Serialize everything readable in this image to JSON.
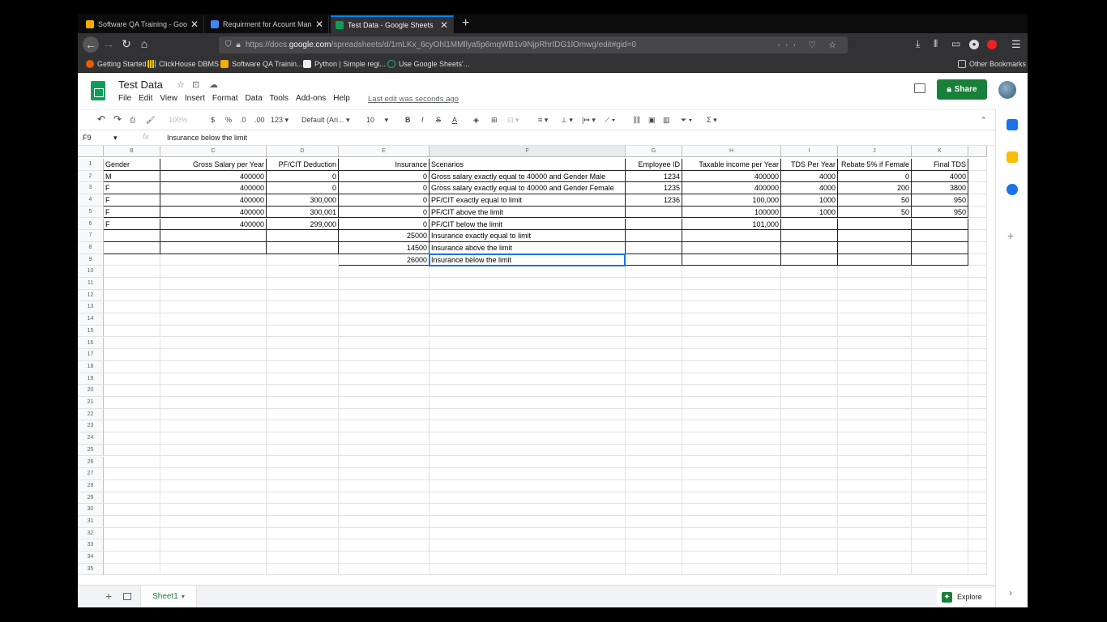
{
  "browser": {
    "tabs": [
      {
        "title": "Software QA Training - Google",
        "color": "#f9ab00"
      },
      {
        "title": "Requirment for Acount Manage",
        "color": "#4285f4"
      },
      {
        "title": "Test Data - Google Sheets",
        "color": "#0f9d58"
      }
    ],
    "url_prefix": "https://docs.",
    "url_domain": "google.com",
    "url_path": "/spreadsheets/d/1mLKx_6cyOhl1MMllya5p6mqWB1v9NjpRhrIDG1lOmwg/edit#gid=0",
    "url_actions": "··· ♡ ☆",
    "bookmarks": [
      "Getting Started",
      "ClickHouse DBMS",
      "Software QA Trainin...",
      "Python | Simple regi...",
      "Use Google Sheets'..."
    ],
    "other_bookmarks": "Other Bookmarks"
  },
  "sheets": {
    "doc_title": "Test Data",
    "menu": [
      "File",
      "Edit",
      "View",
      "Insert",
      "Format",
      "Data",
      "Tools",
      "Add-ons",
      "Help"
    ],
    "last_edit": "Last edit was seconds ago",
    "share_label": "Share",
    "toolbar": {
      "zoom": "100%",
      "currency": "$",
      "percent": "%",
      "dec_less": ".0",
      "dec_more": ".00",
      "format": "123",
      "font": "Default (Ari...",
      "size": "10"
    },
    "name_box": "F9",
    "formula": "Insurance below the limit",
    "columns": [
      "B",
      "C",
      "D",
      "E",
      "F",
      "G",
      "H",
      "I",
      "J",
      "K"
    ],
    "rows": [
      [
        "Gender",
        "Gross Salary per Year",
        "PF/CIT Deduction",
        "Insurance",
        "Scenarios",
        "Employee ID",
        "Taxable income per Year",
        "TDS Per Year",
        "Rebate 5% if Female",
        "Final TDS"
      ],
      [
        "M",
        "400000",
        "0",
        "0",
        "Gross salary exactly equal to 40000 and Gender Male",
        "1234",
        "400000",
        "4000",
        "0",
        "4000"
      ],
      [
        "F",
        "400000",
        "0",
        "0",
        "Gross salary exactly equal to 40000 and Gender Female",
        "1235",
        "400000",
        "4000",
        "200",
        "3800"
      ],
      [
        "F",
        "400000",
        "300,000",
        "0",
        "PF/CIT exactly equal to limit",
        "1236",
        "100,000",
        "1000",
        "50",
        "950"
      ],
      [
        "F",
        "400000",
        "300,001",
        "0",
        "PF/CIT above the limit",
        "",
        "100000",
        "1000",
        "50",
        "950"
      ],
      [
        "F",
        "400000",
        "299,000",
        "0",
        "PF/CIT below the limit",
        "",
        "101,000",
        "",
        "",
        ""
      ],
      [
        "",
        "",
        "",
        "25000",
        "Insurance exactly equal to limit",
        "",
        "",
        "",
        "",
        ""
      ],
      [
        "",
        "",
        "",
        "14500",
        "Insurance above the limit",
        "",
        "",
        "",
        "",
        ""
      ],
      [
        "",
        "",
        "",
        "26000",
        "Insurance below the limit",
        "",
        "",
        "",
        "",
        ""
      ]
    ],
    "row_count": 35,
    "sheet_name": "Sheet1",
    "explore_label": "Explore"
  }
}
